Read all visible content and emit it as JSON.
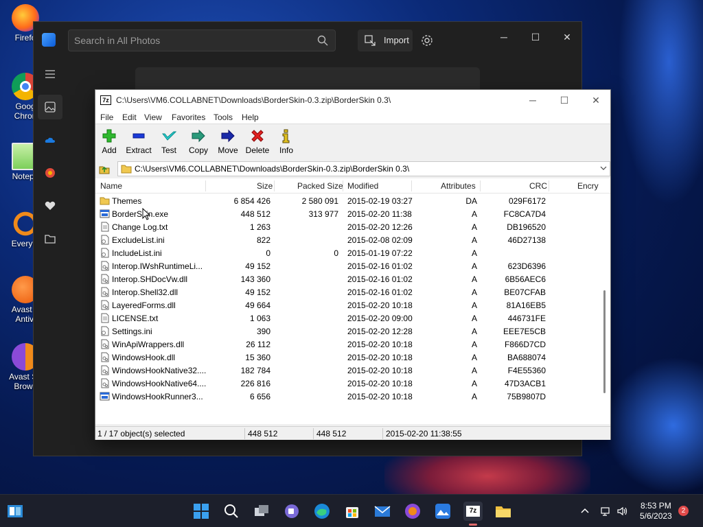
{
  "desktop": {
    "icons": [
      {
        "label": "Firefo",
        "icon": "firefox-icon"
      },
      {
        "label": "Goog",
        "label2": "Chron",
        "icon": "chrome-icon"
      },
      {
        "label": "Notepa",
        "icon": "notepad-icon"
      },
      {
        "label": "Everyth",
        "icon": "everything-search-icon"
      },
      {
        "label": "Avast F",
        "label2": "Antivi",
        "icon": "avast-icon"
      },
      {
        "label": "Avast Se",
        "label2": "Brows",
        "icon": "avast-browser-icon"
      }
    ]
  },
  "photos": {
    "search_placeholder": "Search in All Photos",
    "import_label": "Import",
    "window_controls": {
      "minimize": "─",
      "maximize": "☐",
      "close": "✕"
    }
  },
  "sevenzip": {
    "title": "C:\\Users\\VM6.COLLABNET\\Downloads\\BorderSkin-0.3.zip\\BorderSkin 0.3\\",
    "app_icon_text": "7z",
    "window_controls": {
      "minimize": "─",
      "maximize": "☐",
      "close": "✕"
    },
    "menu": [
      "File",
      "Edit",
      "View",
      "Favorites",
      "Tools",
      "Help"
    ],
    "toolbar": [
      {
        "label": "Add",
        "icon": "add-plus-icon"
      },
      {
        "label": "Extract",
        "icon": "extract-minus-icon"
      },
      {
        "label": "Test",
        "icon": "test-check-icon"
      },
      {
        "label": "Copy",
        "icon": "copy-arrow-icon"
      },
      {
        "label": "Move",
        "icon": "move-arrow-icon"
      },
      {
        "label": "Delete",
        "icon": "delete-x-icon"
      },
      {
        "label": "Info",
        "icon": "info-icon"
      }
    ],
    "address": "C:\\Users\\VM6.COLLABNET\\Downloads\\BorderSkin-0.3.zip\\BorderSkin 0.3\\",
    "columns": [
      "Name",
      "Size",
      "Packed Size",
      "Modified",
      "Attributes",
      "CRC",
      "Encry"
    ],
    "files": [
      {
        "name": "Themes",
        "size": "6 854 426",
        "packed": "2 580 091",
        "modified": "2015-02-19 03:27",
        "attr": "DA",
        "crc": "029F6172",
        "type": "folder"
      },
      {
        "name": "BorderSkin.exe",
        "size": "448 512",
        "packed": "313 977",
        "modified": "2015-02-20 11:38",
        "attr": "A",
        "crc": "FC8CA7D4",
        "type": "exe"
      },
      {
        "name": "Change Log.txt",
        "size": "1 263",
        "packed": "",
        "modified": "2015-02-20 12:26",
        "attr": "A",
        "crc": "DB196520",
        "type": "txt"
      },
      {
        "name": "ExcludeList.ini",
        "size": "822",
        "packed": "",
        "modified": "2015-02-08 02:09",
        "attr": "A",
        "crc": "46D27138",
        "type": "ini"
      },
      {
        "name": "IncludeList.ini",
        "size": "0",
        "packed": "0",
        "modified": "2015-01-19 07:22",
        "attr": "A",
        "crc": "",
        "type": "ini"
      },
      {
        "name": "Interop.IWshRuntimeLi...",
        "size": "49 152",
        "packed": "",
        "modified": "2015-02-16 01:02",
        "attr": "A",
        "crc": "623D6396",
        "type": "dll"
      },
      {
        "name": "Interop.SHDocVw.dll",
        "size": "143 360",
        "packed": "",
        "modified": "2015-02-16 01:02",
        "attr": "A",
        "crc": "6B56AEC6",
        "type": "dll"
      },
      {
        "name": "Interop.Shell32.dll",
        "size": "49 152",
        "packed": "",
        "modified": "2015-02-16 01:02",
        "attr": "A",
        "crc": "BE07CFAB",
        "type": "dll"
      },
      {
        "name": "LayeredForms.dll",
        "size": "49 664",
        "packed": "",
        "modified": "2015-02-20 10:18",
        "attr": "A",
        "crc": "81A16EB5",
        "type": "dll"
      },
      {
        "name": "LICENSE.txt",
        "size": "1 063",
        "packed": "",
        "modified": "2015-02-20 09:00",
        "attr": "A",
        "crc": "446731FE",
        "type": "txt"
      },
      {
        "name": "Settings.ini",
        "size": "390",
        "packed": "",
        "modified": "2015-02-20 12:28",
        "attr": "A",
        "crc": "EEE7E5CB",
        "type": "ini"
      },
      {
        "name": "WinApiWrappers.dll",
        "size": "26 112",
        "packed": "",
        "modified": "2015-02-20 10:18",
        "attr": "A",
        "crc": "F866D7CD",
        "type": "dll"
      },
      {
        "name": "WindowsHook.dll",
        "size": "15 360",
        "packed": "",
        "modified": "2015-02-20 10:18",
        "attr": "A",
        "crc": "BA688074",
        "type": "dll"
      },
      {
        "name": "WindowsHookNative32....",
        "size": "182 784",
        "packed": "",
        "modified": "2015-02-20 10:18",
        "attr": "A",
        "crc": "F4E55360",
        "type": "dll"
      },
      {
        "name": "WindowsHookNative64....",
        "size": "226 816",
        "packed": "",
        "modified": "2015-02-20 10:18",
        "attr": "A",
        "crc": "47D3ACB1",
        "type": "dll"
      },
      {
        "name": "WindowsHookRunner3...",
        "size": "6 656",
        "packed": "",
        "modified": "2015-02-20 10:18",
        "attr": "A",
        "crc": "75B9807D",
        "type": "exe"
      }
    ],
    "status": {
      "selection": "1 / 17 object(s) selected",
      "size": "448 512",
      "packed": "448 512",
      "modified": "2015-02-20 11:38:55"
    }
  },
  "taskbar": {
    "time": "8:53 PM",
    "date": "5/6/2023",
    "notification_count": "2",
    "accent": "#e06a6a"
  }
}
